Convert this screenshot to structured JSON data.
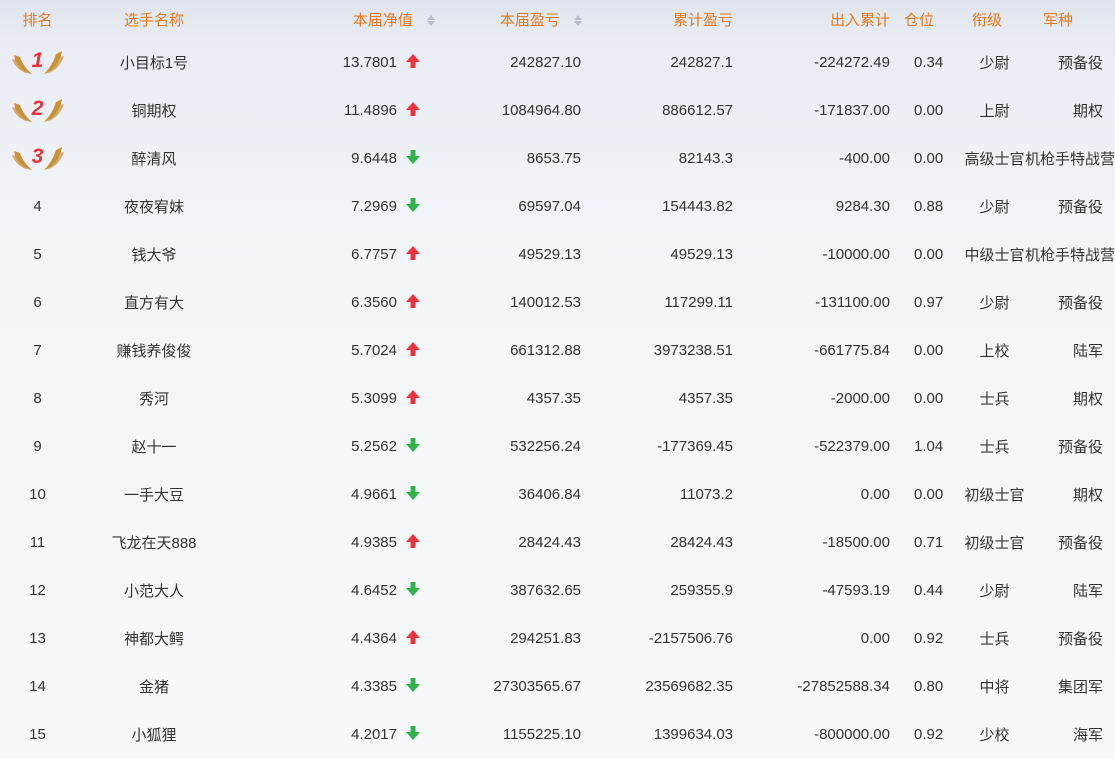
{
  "colors": {
    "header_text": "#e07b20",
    "up_arrow": "#e8343a",
    "down_arrow": "#2fb24a",
    "medal_number": "#e8343a",
    "wing": "#c9923a"
  },
  "header": {
    "rank": "排名",
    "name": "选手名称",
    "nav": "本届净值",
    "profit": "本届盈亏",
    "cum_profit": "累计盈亏",
    "flow": "出入累计",
    "position": "仓位",
    "title": "衔级",
    "branch": "军种"
  },
  "rows": [
    {
      "rank": "1",
      "medal": true,
      "name": "小目标1号",
      "nav": "13.7801",
      "trend": "up",
      "profit": "242827.10",
      "cum_profit": "242827.1",
      "flow": "-224272.49",
      "position": "0.34",
      "title": "少尉",
      "branch": "预备役"
    },
    {
      "rank": "2",
      "medal": true,
      "name": "铜期权",
      "nav": "11.4896",
      "trend": "up",
      "profit": "1084964.80",
      "cum_profit": "886612.57",
      "flow": "-171837.00",
      "position": "0.00",
      "title": "上尉",
      "branch": "期权"
    },
    {
      "rank": "3",
      "medal": true,
      "name": "醉清风",
      "nav": "9.6448",
      "trend": "down",
      "profit": "8653.75",
      "cum_profit": "82143.3",
      "flow": "-400.00",
      "position": "0.00",
      "title": "高级士官",
      "branch": "机枪手特战营"
    },
    {
      "rank": "4",
      "medal": false,
      "name": "夜夜宥妹",
      "nav": "7.2969",
      "trend": "down",
      "profit": "69597.04",
      "cum_profit": "154443.82",
      "flow": "9284.30",
      "position": "0.88",
      "title": "少尉",
      "branch": "预备役"
    },
    {
      "rank": "5",
      "medal": false,
      "name": "钱大爷",
      "nav": "6.7757",
      "trend": "up",
      "profit": "49529.13",
      "cum_profit": "49529.13",
      "flow": "-10000.00",
      "position": "0.00",
      "title": "中级士官",
      "branch": "机枪手特战营"
    },
    {
      "rank": "6",
      "medal": false,
      "name": "直方有大",
      "nav": "6.3560",
      "trend": "up",
      "profit": "140012.53",
      "cum_profit": "117299.11",
      "flow": "-131100.00",
      "position": "0.97",
      "title": "少尉",
      "branch": "预备役"
    },
    {
      "rank": "7",
      "medal": false,
      "name": "赚钱养俊俊",
      "nav": "5.7024",
      "trend": "up",
      "profit": "661312.88",
      "cum_profit": "3973238.51",
      "flow": "-661775.84",
      "position": "0.00",
      "title": "上校",
      "branch": "陆军"
    },
    {
      "rank": "8",
      "medal": false,
      "name": "秀河",
      "nav": "5.3099",
      "trend": "up",
      "profit": "4357.35",
      "cum_profit": "4357.35",
      "flow": "-2000.00",
      "position": "0.00",
      "title": "士兵",
      "branch": "期权"
    },
    {
      "rank": "9",
      "medal": false,
      "name": "赵十一",
      "nav": "5.2562",
      "trend": "down",
      "profit": "532256.24",
      "cum_profit": "-177369.45",
      "flow": "-522379.00",
      "position": "1.04",
      "title": "士兵",
      "branch": "预备役"
    },
    {
      "rank": "10",
      "medal": false,
      "name": "一手大豆",
      "nav": "4.9661",
      "trend": "down",
      "profit": "36406.84",
      "cum_profit": "11073.2",
      "flow": "0.00",
      "position": "0.00",
      "title": "初级士官",
      "branch": "期权"
    },
    {
      "rank": "11",
      "medal": false,
      "name": "飞龙在天888",
      "nav": "4.9385",
      "trend": "up",
      "profit": "28424.43",
      "cum_profit": "28424.43",
      "flow": "-18500.00",
      "position": "0.71",
      "title": "初级士官",
      "branch": "预备役"
    },
    {
      "rank": "12",
      "medal": false,
      "name": "小范大人",
      "nav": "4.6452",
      "trend": "down",
      "profit": "387632.65",
      "cum_profit": "259355.9",
      "flow": "-47593.19",
      "position": "0.44",
      "title": "少尉",
      "branch": "陆军"
    },
    {
      "rank": "13",
      "medal": false,
      "name": "神都大鳄",
      "nav": "4.4364",
      "trend": "up",
      "profit": "294251.83",
      "cum_profit": "-2157506.76",
      "flow": "0.00",
      "position": "0.92",
      "title": "士兵",
      "branch": "预备役"
    },
    {
      "rank": "14",
      "medal": false,
      "name": "金猪",
      "nav": "4.3385",
      "trend": "down",
      "profit": "27303565.67",
      "cum_profit": "23569682.35",
      "flow": "-27852588.34",
      "position": "0.80",
      "title": "中将",
      "branch": "集团军"
    },
    {
      "rank": "15",
      "medal": false,
      "name": "小狐狸",
      "nav": "4.2017",
      "trend": "down",
      "profit": "1155225.10",
      "cum_profit": "1399634.03",
      "flow": "-800000.00",
      "position": "0.92",
      "title": "少校",
      "branch": "海军"
    }
  ]
}
